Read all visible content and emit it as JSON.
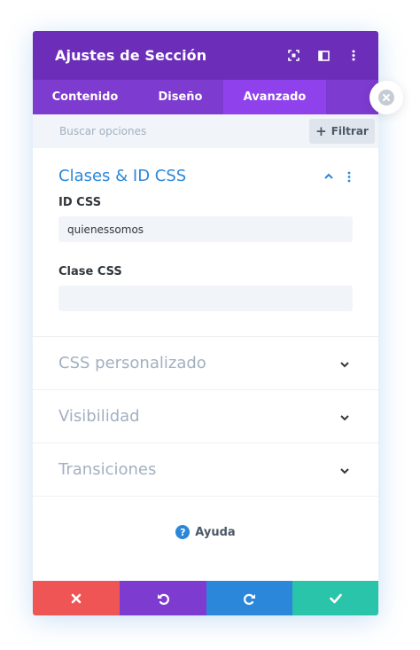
{
  "colors": {
    "header_bg": "#6c2eb9",
    "tabs_bg": "#7e3bd0",
    "active_tab_bg": "#8f42ec",
    "accent_blue": "#2b87da",
    "cancel": "#ef5555",
    "undo": "#7e3bd0",
    "redo": "#2b87da",
    "save": "#29c4a9"
  },
  "header": {
    "title": "Ajustes de Sección",
    "icons": [
      "expand-icon",
      "sidebar-layout-icon",
      "more-vertical-icon"
    ]
  },
  "tabs": [
    {
      "label": "Contenido",
      "active": false
    },
    {
      "label": "Diseño",
      "active": false
    },
    {
      "label": "Avanzado",
      "active": true
    }
  ],
  "search": {
    "placeholder": "Buscar opciones",
    "value": "",
    "filter_label": "Filtrar"
  },
  "sections": {
    "open": {
      "title": "Clases & ID CSS",
      "fields": [
        {
          "label": "ID CSS",
          "value": "quienessomos"
        },
        {
          "label": "Clase CSS",
          "value": ""
        }
      ]
    },
    "closed": [
      {
        "title": "CSS personalizado"
      },
      {
        "title": "Visibilidad"
      },
      {
        "title": "Transiciones"
      }
    ]
  },
  "help": {
    "label": "Ayuda",
    "icon_glyph": "?"
  },
  "footer": {
    "buttons": [
      "cancel-icon",
      "undo-icon",
      "redo-icon",
      "save-check-icon"
    ]
  }
}
